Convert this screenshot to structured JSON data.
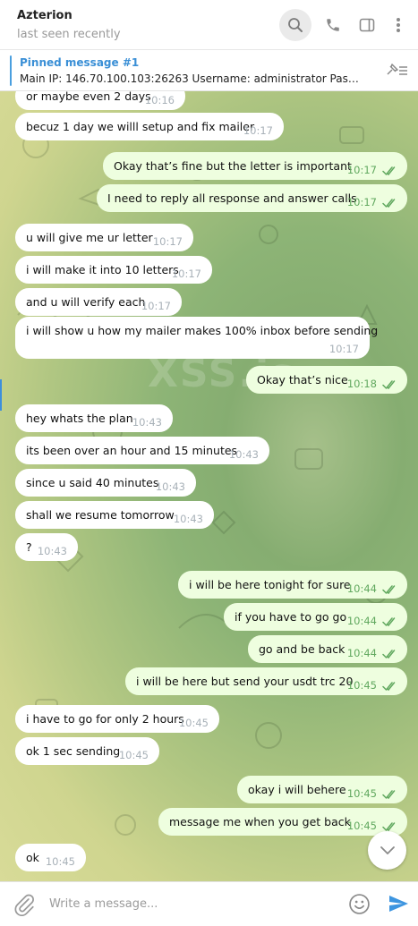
{
  "header": {
    "title": "Azterion",
    "status": "last seen recently",
    "icons": [
      "search-icon",
      "phone-icon",
      "sidebar-toggle-icon",
      "more-vertical-icon"
    ]
  },
  "pinned": {
    "title": "Pinned message #1",
    "text": "Main IP: 146.70.100.103:26263  Username: administrator  Passw..."
  },
  "watermark": "XSS.is",
  "messages": [
    {
      "dir": "in",
      "text": "or maybe even 2 days",
      "time": "10:16"
    },
    {
      "dir": "in",
      "text": "becuz 1 day we willl setup and fix mailer",
      "time": "10:17"
    },
    {
      "dir": "out",
      "text": "Okay that’s fine but the letter is important",
      "time": "10:17"
    },
    {
      "dir": "out",
      "text": "I need to reply all response and answer calls",
      "time": "10:17"
    },
    {
      "dir": "in",
      "text": "u will give me ur letter",
      "time": "10:17"
    },
    {
      "dir": "in",
      "text": "i will make it into 10 letters",
      "time": "10:17"
    },
    {
      "dir": "in",
      "text": "and u will verify each",
      "time": "10:17"
    },
    {
      "dir": "in",
      "text": "i will show u how my mailer makes 100% inbox before sending",
      "time": "10:17"
    },
    {
      "dir": "out",
      "text": "Okay that’s nice",
      "time": "10:18"
    },
    {
      "dir": "in",
      "text": "hey whats the plan",
      "time": "10:43"
    },
    {
      "dir": "in",
      "text": "its been over an hour and 15 minutes",
      "time": "10:43"
    },
    {
      "dir": "in",
      "text": "since u said 40 minutes",
      "time": "10:43"
    },
    {
      "dir": "in",
      "text": "shall we resume tomorrow",
      "time": "10:43"
    },
    {
      "dir": "in",
      "text": "?",
      "time": "10:43"
    },
    {
      "dir": "out",
      "text": "i will be here tonight for sure",
      "time": "10:44"
    },
    {
      "dir": "out",
      "text": "if you have to go go",
      "time": "10:44"
    },
    {
      "dir": "out",
      "text": "go and be back",
      "time": "10:44"
    },
    {
      "dir": "out",
      "text": "i will be here but send your usdt trc 20",
      "time": "10:45"
    },
    {
      "dir": "in",
      "text": "i have to go for only 2 hours",
      "time": "10:45"
    },
    {
      "dir": "in",
      "text": "ok 1 sec sending",
      "time": "10:45"
    },
    {
      "dir": "out",
      "text": "okay i will behere",
      "time": "10:45"
    },
    {
      "dir": "out",
      "text": "message me when you get back",
      "time": "10:45"
    },
    {
      "dir": "in",
      "text": "ok",
      "time": "10:45"
    }
  ],
  "composer": {
    "placeholder": "Write a message...",
    "icons": [
      "attach-icon",
      "emoji-icon",
      "send-icon"
    ]
  },
  "colors": {
    "outgoing_bubble": "#eefedf",
    "incoming_bubble": "#ffffff",
    "accent": "#3d8fdc",
    "read_tick": "#62a960"
  }
}
